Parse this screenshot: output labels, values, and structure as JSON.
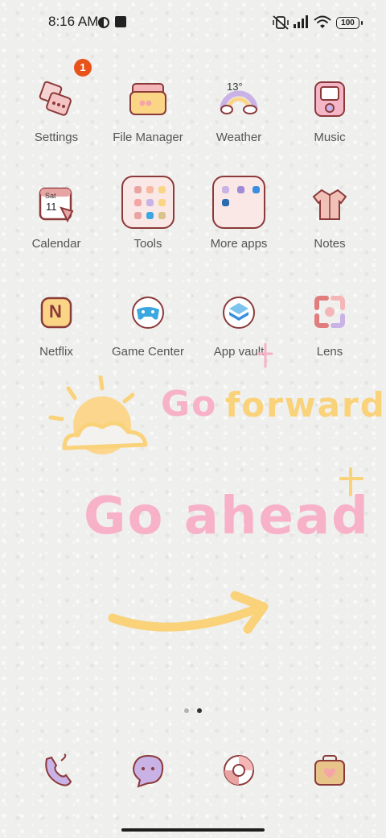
{
  "status_bar": {
    "time": "8:16 AM",
    "battery": "100",
    "icons": [
      "vpn-key-icon",
      "square-notification-icon",
      "vibrate-off-icon",
      "signal-icon",
      "wifi-icon",
      "battery-icon"
    ]
  },
  "apps": {
    "row1": [
      {
        "label": "Settings",
        "icon": "settings-icon",
        "badge": "1"
      },
      {
        "label": "File Manager",
        "icon": "folder-bag-icon"
      },
      {
        "label": "Weather",
        "icon": "weather-rainbow-icon",
        "temp": "13°"
      },
      {
        "label": "Music",
        "icon": "music-player-icon"
      }
    ],
    "row2": [
      {
        "label": "Calendar",
        "icon": "calendar-icon",
        "day": "Sat",
        "date": "11"
      },
      {
        "label": "Tools",
        "icon": "folder-icon"
      },
      {
        "label": "More apps",
        "icon": "folder-icon"
      },
      {
        "label": "Notes",
        "icon": "notes-shirt-icon"
      }
    ],
    "row3": [
      {
        "label": "Netflix",
        "icon": "netflix-icon",
        "glyph": "N"
      },
      {
        "label": "Game Center",
        "icon": "gamepad-icon"
      },
      {
        "label": "App vault",
        "icon": "app-vault-icon"
      },
      {
        "label": "Lens",
        "icon": "lens-icon"
      }
    ]
  },
  "wallpaper": {
    "line1_a": "Go",
    "line1_b": "forward",
    "line2": "Go ahead",
    "colors": {
      "pink": "#f7b1c9",
      "yellow": "#f9d27a"
    }
  },
  "page_indicator": {
    "pages": 2,
    "current": 2
  },
  "dock": [
    {
      "icon": "phone-icon"
    },
    {
      "icon": "messages-icon"
    },
    {
      "icon": "browser-icon"
    },
    {
      "icon": "app-store-icon"
    }
  ]
}
